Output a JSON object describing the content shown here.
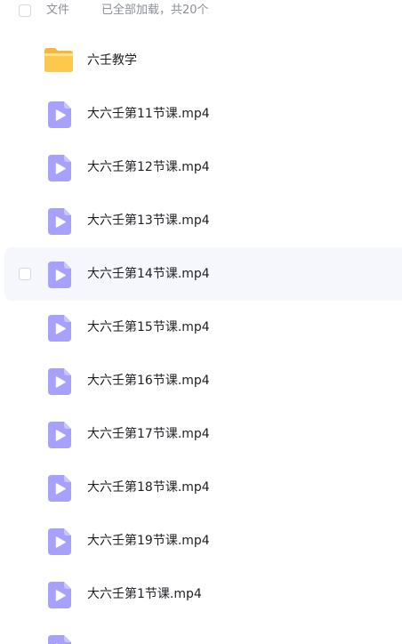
{
  "header": {
    "column_label": "文件",
    "status_text": "已全部加载，共20个"
  },
  "colors": {
    "video_icon": "#a7a1fb",
    "folder_icon": "#fdc84b",
    "hover_row": "#f6f7fc"
  },
  "files": [
    {
      "name": "六壬教学",
      "type": "folder",
      "icon": "folder-icon"
    },
    {
      "name": "大六壬第11节课.mp4",
      "type": "video",
      "icon": "video-file-icon"
    },
    {
      "name": "大六壬第12节课.mp4",
      "type": "video",
      "icon": "video-file-icon"
    },
    {
      "name": "大六壬第13节课.mp4",
      "type": "video",
      "icon": "video-file-icon"
    },
    {
      "name": "大六壬第14节课.mp4",
      "type": "video",
      "icon": "video-file-icon",
      "hovered": true
    },
    {
      "name": "大六壬第15节课.mp4",
      "type": "video",
      "icon": "video-file-icon"
    },
    {
      "name": "大六壬第16节课.mp4",
      "type": "video",
      "icon": "video-file-icon"
    },
    {
      "name": "大六壬第17节课.mp4",
      "type": "video",
      "icon": "video-file-icon"
    },
    {
      "name": "大六壬第18节课.mp4",
      "type": "video",
      "icon": "video-file-icon"
    },
    {
      "name": "大六壬第19节课.mp4",
      "type": "video",
      "icon": "video-file-icon"
    },
    {
      "name": "大六壬第1节课.mp4",
      "type": "video",
      "icon": "video-file-icon"
    },
    {
      "name": "",
      "type": "video",
      "icon": "video-file-icon"
    }
  ]
}
